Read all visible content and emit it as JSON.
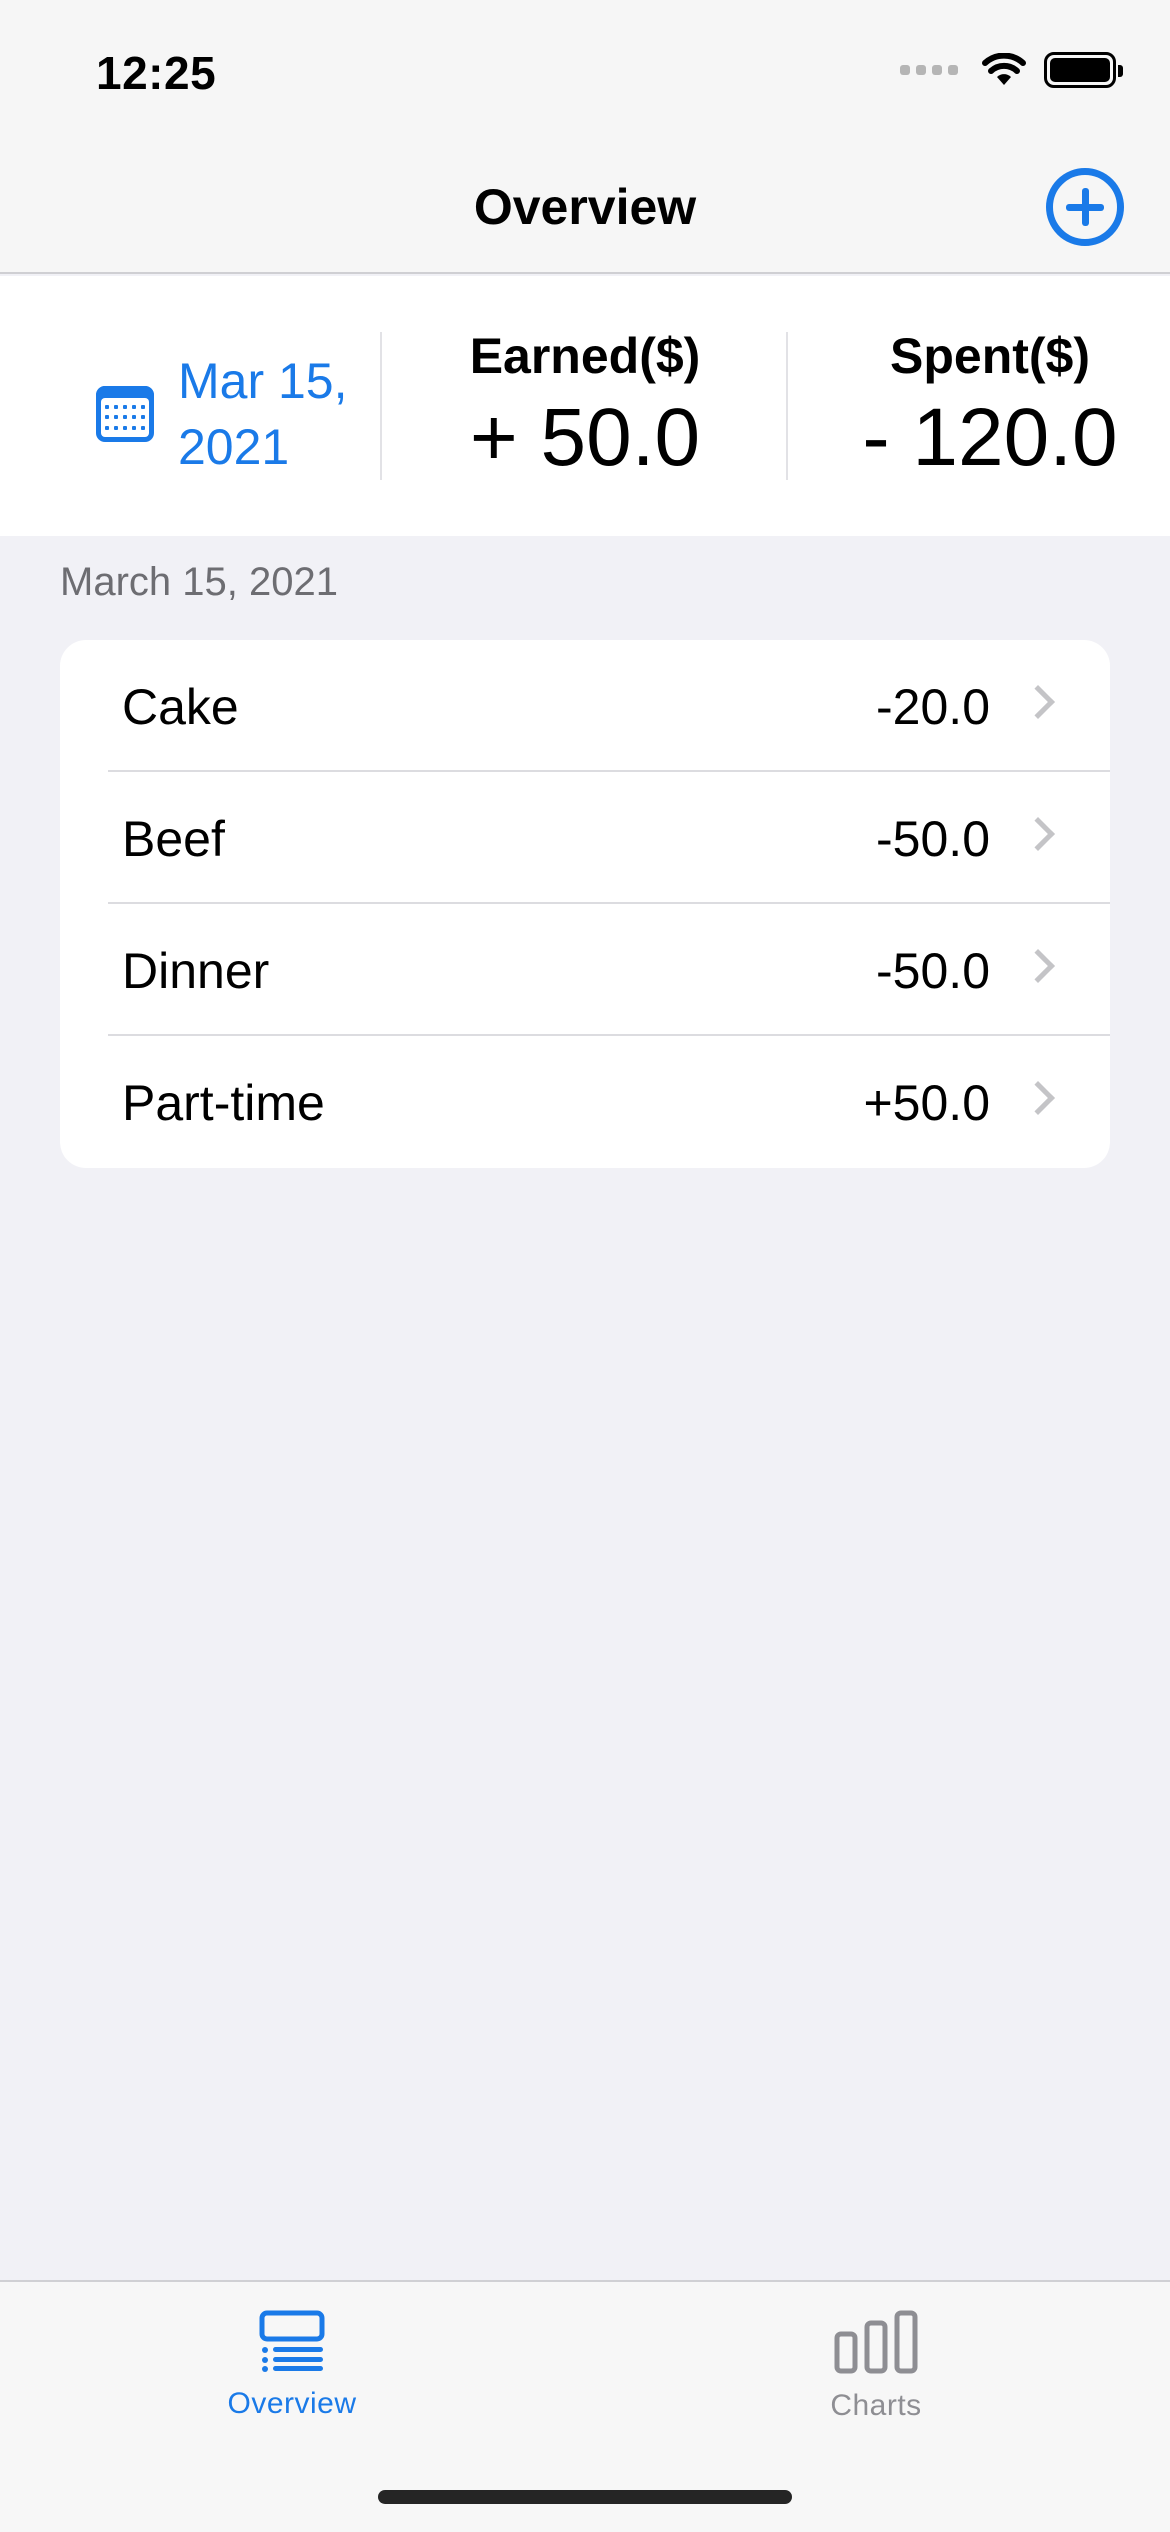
{
  "status_bar": {
    "time": "12:25"
  },
  "nav": {
    "title": "Overview"
  },
  "summary": {
    "date": "Mar 15, 2021",
    "earned_label": "Earned($)",
    "earned_value": "+ 50.0",
    "spent_label": "Spent($)",
    "spent_value": "- 120.0"
  },
  "section": {
    "header": "March 15, 2021",
    "items": [
      {
        "name": "Cake",
        "amount": "-20.0"
      },
      {
        "name": "Beef",
        "amount": "-50.0"
      },
      {
        "name": "Dinner",
        "amount": "-50.0"
      },
      {
        "name": "Part-time",
        "amount": "+50.0"
      }
    ]
  },
  "tab_bar": {
    "tabs": [
      {
        "label": "Overview",
        "icon": "list-icon",
        "selected": true
      },
      {
        "label": "Charts",
        "icon": "chart-bar-icon",
        "selected": false
      }
    ]
  },
  "colors": {
    "accent": "#1a7ae8",
    "inactive_tab": "#8e8e93",
    "background": "#f1f1f6"
  }
}
